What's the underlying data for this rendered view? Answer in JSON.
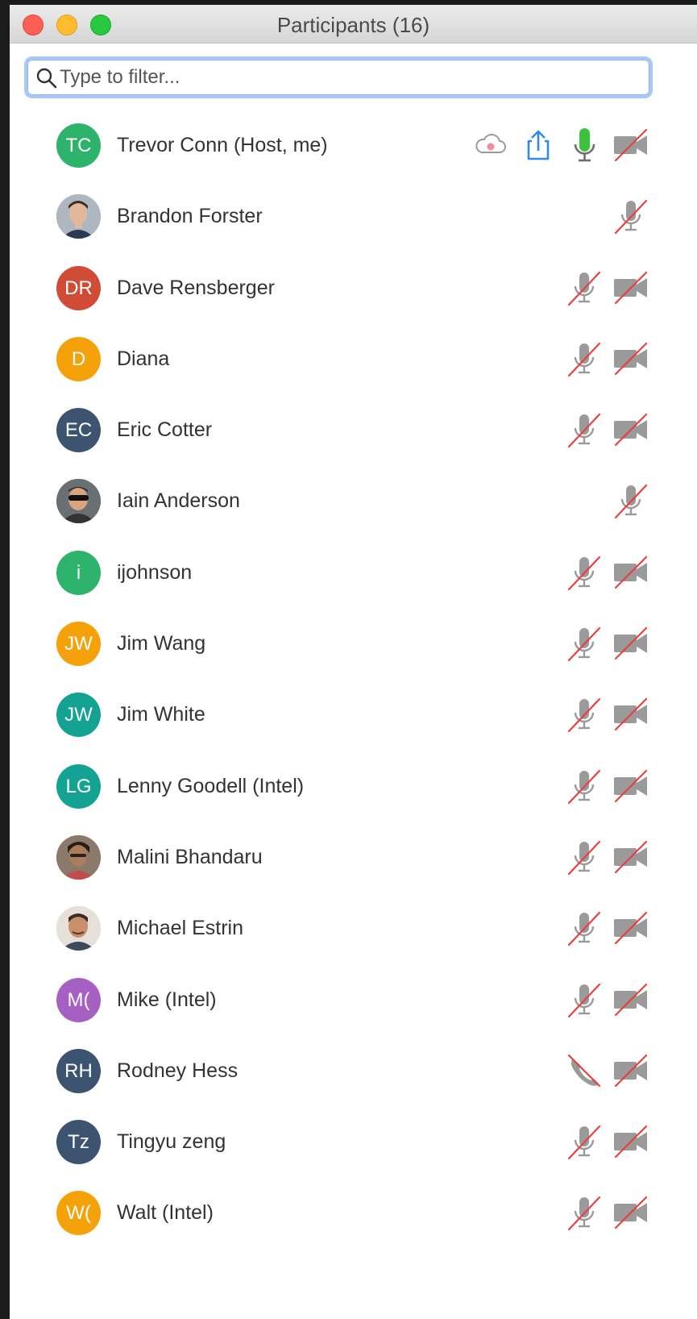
{
  "window": {
    "title": "Participants (16)"
  },
  "search": {
    "placeholder": "Type to filter..."
  },
  "colors": {
    "green": "#2db36b",
    "red": "#d04c36",
    "orange": "#f5a20a",
    "slate": "#3d5470",
    "teal": "#14a392",
    "purple": "#a65fc2",
    "mute_slash": "#e8413d",
    "icon_gray": "#9a9a9a",
    "share_blue": "#2e8be6",
    "mic_active": "#3cc23c"
  },
  "participants": [
    {
      "name": "Trevor Conn (Host, me)",
      "initials": "TC",
      "avatar_color": "#2db36b",
      "photo": false,
      "icons": [
        "cloud-record-icon",
        "share-screen-icon",
        "microphone-on-icon",
        "video-off-icon"
      ]
    },
    {
      "name": "Brandon Forster",
      "initials": "",
      "avatar_color": "#7b8894",
      "photo": true,
      "icons": [
        "microphone-muted-icon"
      ]
    },
    {
      "name": "Dave Rensberger",
      "initials": "DR",
      "avatar_color": "#d04c36",
      "photo": false,
      "icons": [
        "microphone-muted-icon",
        "video-off-icon"
      ]
    },
    {
      "name": "Diana",
      "initials": "D",
      "avatar_color": "#f5a20a",
      "photo": false,
      "icons": [
        "microphone-muted-icon",
        "video-off-icon"
      ]
    },
    {
      "name": "Eric Cotter",
      "initials": "EC",
      "avatar_color": "#3d5470",
      "photo": false,
      "icons": [
        "microphone-muted-icon",
        "video-off-icon"
      ]
    },
    {
      "name": "Iain Anderson",
      "initials": "",
      "avatar_color": "#5c6066",
      "photo": true,
      "icons": [
        "microphone-muted-icon"
      ]
    },
    {
      "name": "ijohnson",
      "initials": "i",
      "avatar_color": "#2db36b",
      "photo": false,
      "icons": [
        "microphone-muted-icon",
        "video-off-icon"
      ]
    },
    {
      "name": "Jim Wang",
      "initials": "JW",
      "avatar_color": "#f5a20a",
      "photo": false,
      "icons": [
        "microphone-muted-icon",
        "video-off-icon"
      ]
    },
    {
      "name": "Jim White",
      "initials": "JW",
      "avatar_color": "#14a392",
      "photo": false,
      "icons": [
        "microphone-muted-icon",
        "video-off-icon"
      ]
    },
    {
      "name": "Lenny Goodell (Intel)",
      "initials": "LG",
      "avatar_color": "#14a392",
      "photo": false,
      "icons": [
        "microphone-muted-icon",
        "video-off-icon"
      ]
    },
    {
      "name": "Malini Bhandaru",
      "initials": "",
      "avatar_color": "#8a7a6a",
      "photo": true,
      "icons": [
        "microphone-muted-icon",
        "video-off-icon"
      ]
    },
    {
      "name": "Michael Estrin",
      "initials": "",
      "avatar_color": "#c9b8a6",
      "photo": true,
      "icons": [
        "microphone-muted-icon",
        "video-off-icon"
      ]
    },
    {
      "name": "Mike (Intel)",
      "initials": "M(",
      "avatar_color": "#a65fc2",
      "photo": false,
      "icons": [
        "microphone-muted-icon",
        "video-off-icon"
      ]
    },
    {
      "name": "Rodney Hess",
      "initials": "RH",
      "avatar_color": "#3d5470",
      "photo": false,
      "icons": [
        "phone-muted-icon",
        "video-off-icon"
      ]
    },
    {
      "name": "Tingyu zeng",
      "initials": "Tz",
      "avatar_color": "#3d5470",
      "photo": false,
      "icons": [
        "microphone-muted-icon",
        "video-off-icon"
      ]
    },
    {
      "name": "Walt (Intel)",
      "initials": "W(",
      "avatar_color": "#f5a20a",
      "photo": false,
      "icons": [
        "microphone-muted-icon",
        "video-off-icon"
      ]
    }
  ]
}
